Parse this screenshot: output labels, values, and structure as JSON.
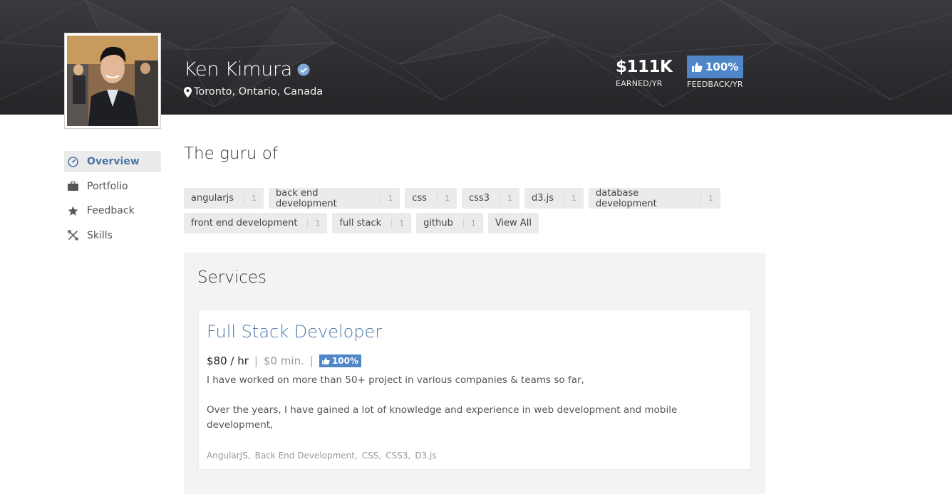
{
  "profile": {
    "name": "Ken Kimura",
    "location": "Toronto, Ontario, Canada",
    "verified": true
  },
  "stats": {
    "earned_value": "$111K",
    "earned_label": "EARNED/YR",
    "feedback_value": "100%",
    "feedback_label": "FEEDBACK/YR"
  },
  "sidebar": {
    "items": [
      {
        "label": "Overview",
        "icon": "dashboard-icon",
        "active": true
      },
      {
        "label": "Portfolio",
        "icon": "briefcase-icon",
        "active": false
      },
      {
        "label": "Feedback",
        "icon": "star-icon",
        "active": false
      },
      {
        "label": "Skills",
        "icon": "tools-icon",
        "active": false
      }
    ]
  },
  "guru": {
    "title": "The guru of",
    "tags": [
      {
        "label": "angularjs",
        "count": "1"
      },
      {
        "label": "back end development",
        "count": "1"
      },
      {
        "label": "css",
        "count": "1"
      },
      {
        "label": "css3",
        "count": "1"
      },
      {
        "label": "d3.js",
        "count": "1"
      },
      {
        "label": "database development",
        "count": "1"
      },
      {
        "label": "front end development",
        "count": "1"
      },
      {
        "label": "full stack",
        "count": "1"
      },
      {
        "label": "github",
        "count": "1"
      }
    ],
    "view_all": "View All"
  },
  "services": {
    "title": "Services",
    "items": [
      {
        "name": "Full Stack Developer",
        "rate": "$80 / hr",
        "min": "$0 min.",
        "feedback": "100%",
        "description": [
          "I have worked on more than 50+ project in various companies & teams so far,",
          "Over the years, I have gained a lot of knowledge and experience in web development and mobile development,"
        ],
        "skills": [
          "AngularJS,",
          "Back End Development,",
          "CSS,",
          "CSS3,",
          "D3.js"
        ]
      }
    ]
  },
  "colors": {
    "accent": "#4b77a8",
    "badge": "#4e86c8",
    "banner": "#2e2e32"
  }
}
